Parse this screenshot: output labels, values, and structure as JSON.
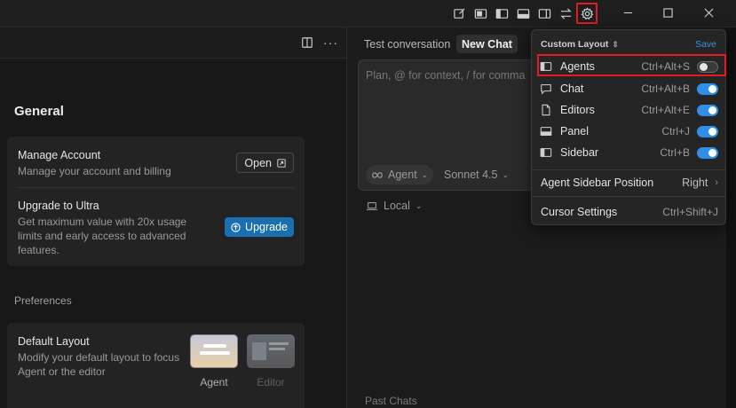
{
  "titlebar": {
    "icons": [
      "compose-icon",
      "layout-agents-icon",
      "layout-sidebar-icon",
      "layout-panel-icon",
      "layout-right-icon",
      "swap-icon",
      "gear-icon"
    ],
    "window_controls": [
      "minimize",
      "maximize",
      "close"
    ]
  },
  "settings": {
    "section_title": "General",
    "manage_account": {
      "title": "Manage Account",
      "desc": "Manage your account and billing",
      "button": "Open"
    },
    "upgrade": {
      "title": "Upgrade to Ultra",
      "desc": "Get maximum value with 20x usage limits and early access to advanced features.",
      "button": "Upgrade"
    },
    "preferences_label": "Preferences",
    "default_layout": {
      "title": "Default Layout",
      "desc": "Modify your default layout to focus Agent or the editor",
      "options": [
        "Agent",
        "Editor"
      ]
    }
  },
  "chat": {
    "tabs": [
      "Test conversation",
      "New Chat"
    ],
    "placeholder": "Plan, @ for context, / for comma",
    "mode": "Agent",
    "model": "Sonnet 4.5",
    "environment": "Local",
    "past_chats": "Past Chats"
  },
  "dropdown": {
    "header": "Custom Layout",
    "save": "Save",
    "items": [
      {
        "label": "Agents",
        "shortcut": "Ctrl+Alt+S",
        "on": false
      },
      {
        "label": "Chat",
        "shortcut": "Ctrl+Alt+B",
        "on": true
      },
      {
        "label": "Editors",
        "shortcut": "Ctrl+Alt+E",
        "on": true
      },
      {
        "label": "Panel",
        "shortcut": "Ctrl+J",
        "on": true
      },
      {
        "label": "Sidebar",
        "shortcut": "Ctrl+B",
        "on": true
      }
    ],
    "agent_sidebar_position": {
      "label": "Agent Sidebar Position",
      "value": "Right"
    },
    "cursor_settings": {
      "label": "Cursor Settings",
      "shortcut": "Ctrl+Shift+J"
    }
  },
  "colors": {
    "accent": "#2f8fe8",
    "upgrade": "#1a6fb0",
    "highlight": "#e01b24"
  }
}
